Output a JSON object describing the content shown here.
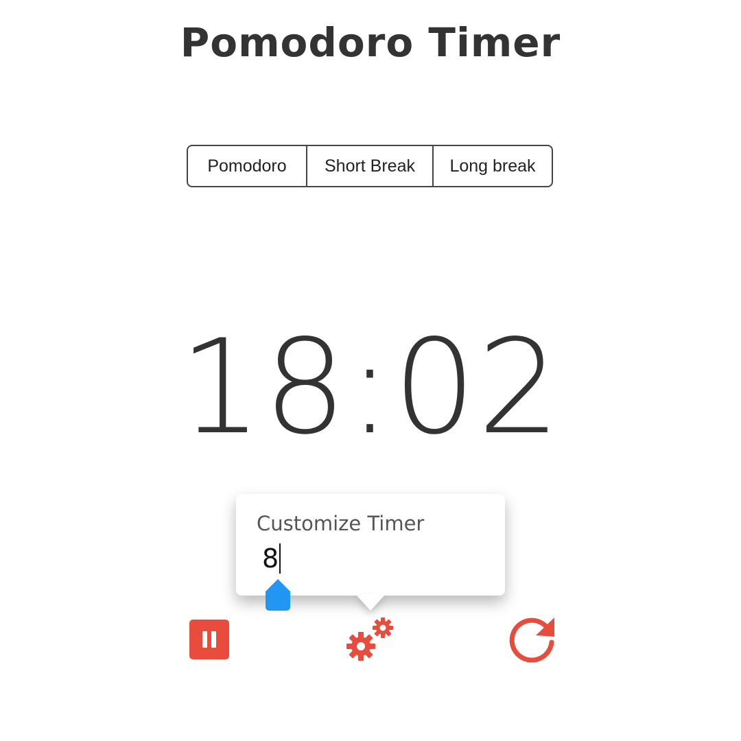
{
  "app": {
    "title": "Pomodoro Timer"
  },
  "modes": {
    "tabs": [
      {
        "label": "Pomodoro"
      },
      {
        "label": "Short Break"
      },
      {
        "label": "Long break"
      }
    ]
  },
  "timer": {
    "display": "18:02"
  },
  "customize": {
    "label": "Customize Timer",
    "value": "8"
  },
  "controls": {
    "pause_icon": "pause-icon",
    "settings_icon": "gears-icon",
    "reset_icon": "reset-icon"
  },
  "colors": {
    "accent": "#e84c3d",
    "handle": "#2196f3",
    "text": "#333333"
  }
}
